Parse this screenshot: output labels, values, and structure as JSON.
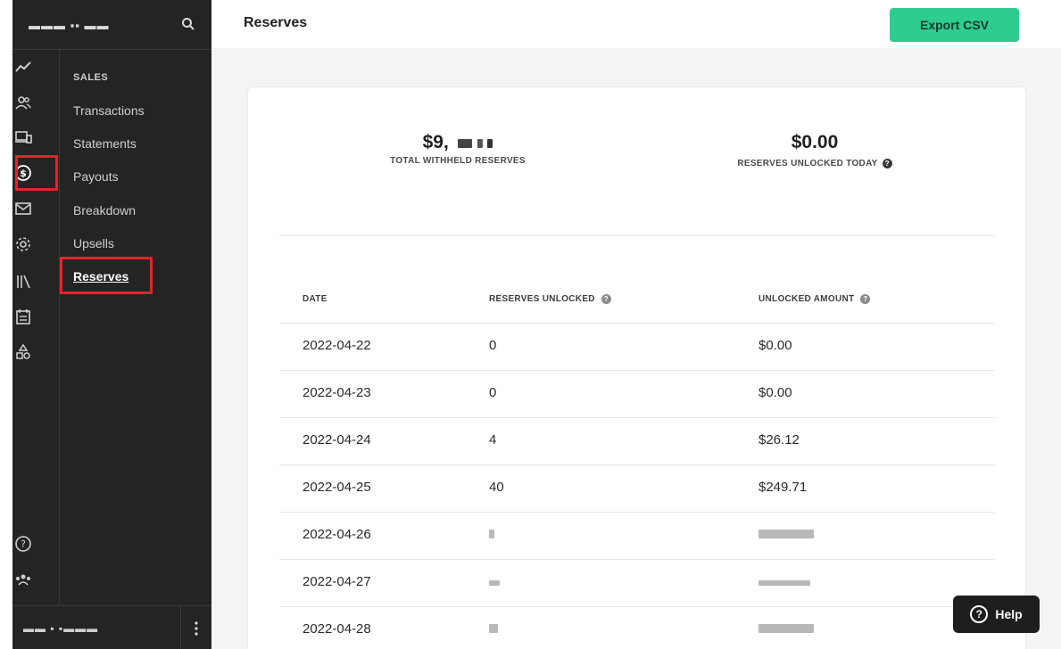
{
  "brand": {
    "name": "▬▬▬ ▪▪ ▬▬"
  },
  "sidebar": {
    "section_label": "SALES",
    "items": [
      {
        "label": "Transactions"
      },
      {
        "label": "Statements"
      },
      {
        "label": "Payouts"
      },
      {
        "label": "Breakdown"
      },
      {
        "label": "Upsells"
      },
      {
        "label": "Reserves"
      }
    ],
    "active_item": "Reserves"
  },
  "rail": {
    "icons": [
      "analytics-icon",
      "customers-icon",
      "devices-icon",
      "dollar-icon",
      "mail-icon",
      "settings-icon",
      "library-icon",
      "calendar-icon",
      "shapes-icon",
      "help-circle-icon",
      "team-icon"
    ],
    "active_icon": "dollar-icon"
  },
  "footer": {
    "user_name": "▬▬ ▪ ▪▬▬▬"
  },
  "header": {
    "title": "Reserves",
    "export_label": "Export CSV"
  },
  "summary": {
    "total_withheld_value": "$9,",
    "total_withheld_label": "TOTAL WITHHELD RESERVES",
    "unlocked_today_value": "$0.00",
    "unlocked_today_label": "RESERVES UNLOCKED TODAY"
  },
  "table": {
    "columns": [
      "DATE",
      "RESERVES UNLOCKED",
      "UNLOCKED AMOUNT"
    ],
    "rows": [
      {
        "date": "2022-04-22",
        "reserves": "0",
        "amount": "$0.00"
      },
      {
        "date": "2022-04-23",
        "reserves": "0",
        "amount": "$0.00"
      },
      {
        "date": "2022-04-24",
        "reserves": "4",
        "amount": "$26.12"
      },
      {
        "date": "2022-04-25",
        "reserves": "40",
        "amount": "$249.71"
      },
      {
        "date": "2022-04-26",
        "reserves": "",
        "amount": ""
      },
      {
        "date": "2022-04-27",
        "reserves": "",
        "amount": ""
      },
      {
        "date": "2022-04-28",
        "reserves": "",
        "amount": ""
      }
    ]
  },
  "help": {
    "label": "Help"
  },
  "colors": {
    "accent": "#2ecc8f",
    "highlight": "#e3242b",
    "sidebar_bg": "#242424"
  }
}
